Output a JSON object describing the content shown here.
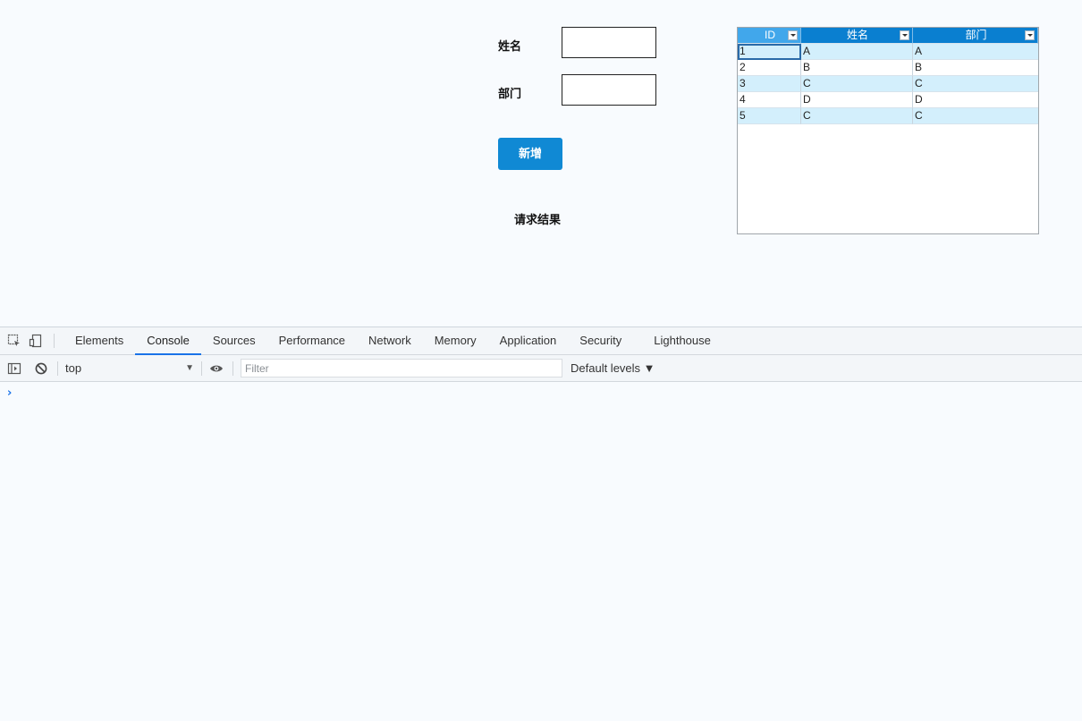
{
  "form": {
    "name_label": "姓名",
    "dept_label": "部门",
    "name_value": "",
    "dept_value": "",
    "add_button": "新增",
    "result_label": "请求结果"
  },
  "grid": {
    "columns": [
      "ID",
      "姓名",
      "部门"
    ],
    "rows": [
      [
        "1",
        "A",
        "A"
      ],
      [
        "2",
        "B",
        "B"
      ],
      [
        "3",
        "C",
        "C"
      ],
      [
        "4",
        "D",
        "D"
      ],
      [
        "5",
        "C",
        "C"
      ]
    ]
  },
  "devtools": {
    "tabs": [
      "Elements",
      "Console",
      "Sources",
      "Performance",
      "Network",
      "Memory",
      "Application",
      "Security",
      "Lighthouse"
    ],
    "active_tab": "Console",
    "context": "top",
    "filter_placeholder": "Filter",
    "levels": "Default levels ▼",
    "prompt": "›"
  },
  "colors": {
    "accent": "#1089d4",
    "grid_header": "#0a7fd0",
    "row_alt": "#d3effc",
    "devtools_active": "#1a73e8"
  }
}
